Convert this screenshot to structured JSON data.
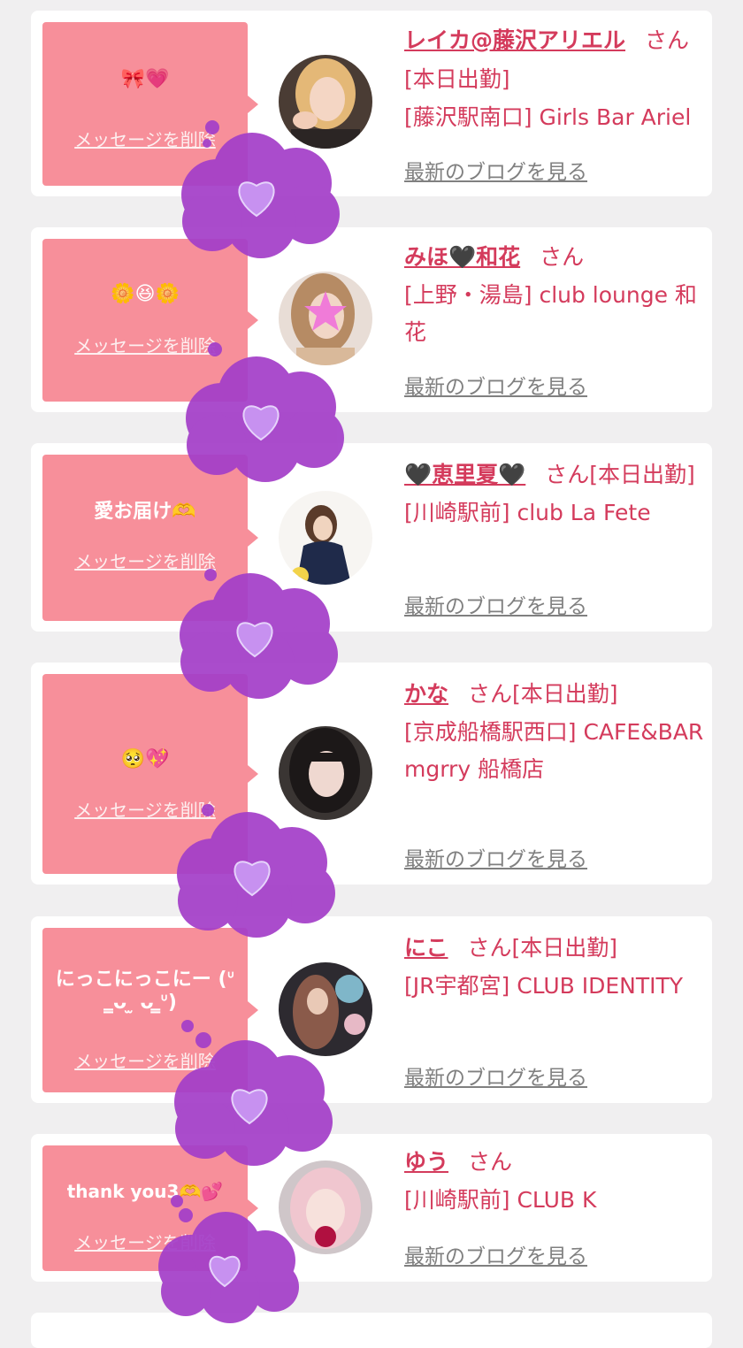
{
  "colors": {
    "accent": "#d43b5c",
    "bubble": "#f78f9a",
    "sticker": "#a43fc9",
    "link_gray": "#808080"
  },
  "stickers": {
    "heart_icon": "purple-heart-icon",
    "cloud_icon": "cloud-icon"
  },
  "entries": [
    {
      "message": "🎀💗",
      "delete_label": "メッセージを削除",
      "name": "レイカ@藤沢アリエル",
      "san": "さん",
      "status": "[本日出勤]",
      "shop": "[藤沢駅南口] Girls Bar Ariel",
      "blog_link": "最新のブログを見る"
    },
    {
      "message": "🌼😆🌼",
      "delete_label": "メッセージを削除",
      "name": "みほ🖤和花",
      "san": "さん",
      "status": "",
      "shop": "[上野・湯島] club lounge 和花",
      "blog_link": "最新のブログを見る"
    },
    {
      "message": "愛お届け🫶",
      "delete_label": "メッセージを削除",
      "name": "🖤恵里夏🖤",
      "san": "さん",
      "status": "[本日出勤]",
      "shop": "[川崎駅前] club La Fete",
      "blog_link": "最新のブログを見る"
    },
    {
      "message": "🥺💖",
      "delete_label": "メッセージを削除",
      "name": "かな",
      "san": "さん",
      "status": "[本日出勤]",
      "shop": "[京成船橋駅西口] CAFE&BAR mgrry 船橋店",
      "blog_link": "最新のブログを見る"
    },
    {
      "message": "にっこにっこにー (ᐡ ̳ᴗ ̫ ᴗ ̳ᐡ)",
      "delete_label": "メッセージを削除",
      "name": "にこ",
      "san": "さん",
      "status": "[本日出勤]",
      "shop": "[JR宇都宮] CLUB IDENTITY",
      "blog_link": "最新のブログを見る"
    },
    {
      "message": "thank you3🫶💕",
      "delete_label": "メッセージを削除",
      "name": "ゆう",
      "san": "さん",
      "status": "",
      "shop": "[川崎駅前] CLUB K",
      "blog_link": "最新のブログを見る"
    }
  ]
}
